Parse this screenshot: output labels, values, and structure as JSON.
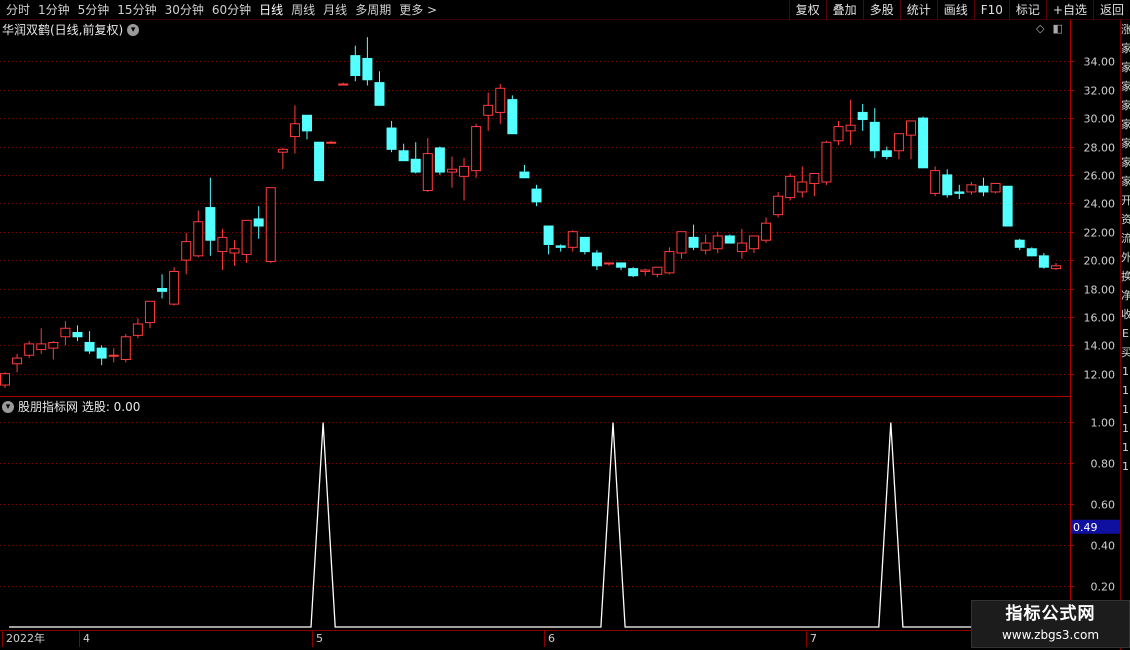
{
  "toolbar": {
    "periods": [
      "分时",
      "1分钟",
      "5分钟",
      "15分钟",
      "30分钟",
      "60分钟",
      "日线",
      "周线",
      "月线",
      "多周期",
      "更多 >"
    ],
    "active_period": "日线",
    "actions": [
      "复权",
      "叠加",
      "多股",
      "统计",
      "画线",
      "F10",
      "标记",
      "+自选",
      "返回"
    ]
  },
  "main_chart": {
    "title": "华润双鹤(日线,前复权)",
    "icons": [
      "◇",
      "◧"
    ],
    "y_ticks": [
      "34.00",
      "32.00",
      "30.00",
      "28.00",
      "26.00",
      "24.00",
      "22.00",
      "20.00",
      "18.00",
      "16.00",
      "14.00",
      "12.00"
    ]
  },
  "sub_chart": {
    "title": "股朋指标网 选股: 0.00",
    "y_ticks": [
      "1.00",
      "0.80",
      "0.60",
      "0.40",
      "0.20"
    ],
    "current_value": "0.49"
  },
  "date_axis": [
    "2022年",
    "4",
    "5",
    "6",
    "7"
  ],
  "right_strip": [
    "涨",
    "家",
    "家",
    "家",
    "家",
    "家",
    "家",
    "家",
    "家",
    "开",
    "资",
    "流",
    "外",
    "换",
    "净",
    "收",
    "E",
    "买",
    "1",
    "1",
    "1",
    "1",
    "1",
    "1"
  ],
  "watermark": {
    "line1": "指标公式网",
    "line2": "www.zbgs3.com"
  },
  "colors": {
    "up": "#ff3c3c",
    "down": "#54ffff",
    "grid": "#7a0000",
    "signal": "#ffffff",
    "value_box": "#1010a0"
  },
  "chart_data": [
    {
      "type": "candlestick",
      "title": "华润双鹤(日线,前复权)",
      "ylim": [
        10.5,
        35.5
      ],
      "ohlc": [
        [
          11.2,
          12.1,
          11.0,
          12.0
        ],
        [
          12.7,
          13.4,
          12.1,
          13.1
        ],
        [
          13.3,
          14.3,
          13.1,
          14.1
        ],
        [
          13.7,
          15.2,
          13.4,
          14.1
        ],
        [
          13.8,
          14.3,
          13.0,
          14.2
        ],
        [
          14.6,
          15.7,
          14.0,
          15.2
        ],
        [
          14.9,
          15.4,
          14.3,
          14.6
        ],
        [
          14.2,
          15.0,
          13.4,
          13.6
        ],
        [
          13.8,
          14.0,
          12.6,
          13.1
        ],
        [
          13.3,
          13.8,
          12.8,
          13.3
        ],
        [
          13.0,
          14.8,
          12.8,
          14.6
        ],
        [
          14.7,
          15.9,
          14.5,
          15.5
        ],
        [
          15.6,
          17.1,
          15.2,
          17.1
        ],
        [
          18.0,
          19.0,
          17.3,
          17.8
        ],
        [
          16.9,
          19.5,
          16.8,
          19.2
        ],
        [
          20.0,
          21.9,
          19.0,
          21.3
        ],
        [
          20.3,
          23.5,
          20.2,
          22.7
        ],
        [
          23.7,
          25.8,
          20.3,
          21.4
        ],
        [
          20.6,
          22.2,
          19.3,
          21.6
        ],
        [
          20.5,
          21.4,
          19.6,
          20.8
        ],
        [
          20.4,
          22.6,
          19.8,
          22.8
        ],
        [
          22.9,
          23.8,
          21.5,
          22.4
        ],
        [
          19.9,
          25.1,
          19.8,
          25.1
        ],
        [
          27.6,
          27.9,
          26.4,
          27.8
        ],
        [
          28.7,
          30.9,
          27.5,
          29.6
        ],
        [
          30.2,
          28.5,
          28.5,
          29.1
        ],
        [
          28.3,
          28.3,
          25.6,
          25.6
        ],
        [
          28.3,
          28.4,
          28.2,
          28.3
        ],
        [
          32.4,
          32.5,
          32.3,
          32.4
        ],
        [
          34.4,
          35.1,
          32.6,
          33.0
        ],
        [
          34.2,
          35.7,
          32.3,
          32.7
        ],
        [
          32.5,
          33.3,
          31.1,
          30.9
        ],
        [
          29.3,
          29.8,
          27.6,
          27.8
        ],
        [
          27.7,
          28.2,
          27.0,
          27.0
        ],
        [
          27.1,
          28.3,
          26.1,
          26.2
        ],
        [
          24.9,
          28.6,
          24.8,
          27.5
        ],
        [
          27.9,
          28.0,
          26.0,
          26.2
        ],
        [
          26.2,
          27.3,
          25.1,
          26.4
        ],
        [
          25.9,
          27.2,
          24.2,
          26.6
        ],
        [
          26.3,
          29.6,
          25.8,
          29.4
        ],
        [
          30.2,
          31.8,
          29.1,
          30.9
        ],
        [
          30.4,
          32.4,
          29.6,
          32.1
        ],
        [
          31.3,
          31.6,
          28.9,
          28.9
        ],
        [
          26.2,
          26.7,
          25.8,
          25.8
        ],
        [
          25.0,
          25.3,
          23.8,
          24.1
        ],
        [
          22.4,
          22.4,
          20.4,
          21.1
        ],
        [
          21.0,
          21.1,
          20.6,
          20.9
        ],
        [
          20.9,
          22.1,
          20.6,
          22.0
        ],
        [
          21.6,
          21.6,
          20.4,
          20.6
        ],
        [
          20.5,
          20.7,
          19.3,
          19.6
        ],
        [
          19.8,
          19.8,
          19.6,
          19.8
        ],
        [
          19.8,
          19.8,
          19.3,
          19.5
        ],
        [
          19.4,
          19.5,
          18.8,
          18.9
        ],
        [
          19.2,
          19.4,
          18.9,
          19.3
        ],
        [
          19.0,
          19.5,
          18.8,
          19.5
        ],
        [
          19.1,
          20.9,
          19.0,
          20.6
        ],
        [
          20.5,
          22.0,
          20.1,
          22.0
        ],
        [
          21.6,
          22.5,
          20.7,
          20.9
        ],
        [
          20.7,
          21.8,
          20.4,
          21.2
        ],
        [
          20.8,
          22.0,
          20.5,
          21.7
        ],
        [
          21.7,
          21.8,
          21.2,
          21.2
        ],
        [
          20.6,
          22.2,
          20.1,
          21.2
        ],
        [
          20.8,
          21.6,
          20.5,
          21.7
        ],
        [
          21.4,
          23.0,
          21.2,
          22.6
        ],
        [
          23.2,
          24.8,
          23.0,
          24.5
        ],
        [
          24.4,
          26.1,
          24.2,
          25.9
        ],
        [
          24.8,
          26.6,
          24.4,
          25.5
        ],
        [
          25.4,
          26.1,
          24.5,
          26.1
        ],
        [
          25.5,
          28.4,
          25.3,
          28.3
        ],
        [
          28.4,
          29.8,
          28.1,
          29.4
        ],
        [
          29.1,
          31.3,
          28.1,
          29.5
        ],
        [
          30.4,
          31.0,
          29.1,
          29.9
        ],
        [
          29.7,
          30.7,
          27.2,
          27.7
        ],
        [
          27.7,
          28.0,
          27.1,
          27.3
        ],
        [
          27.7,
          28.6,
          27.1,
          28.9
        ],
        [
          28.8,
          28.1,
          27.1,
          29.8
        ],
        [
          30.0,
          30.1,
          26.5,
          26.5
        ],
        [
          24.7,
          26.6,
          24.5,
          26.3
        ],
        [
          26.0,
          26.4,
          24.4,
          24.6
        ],
        [
          24.8,
          25.3,
          24.3,
          24.7
        ],
        [
          24.8,
          25.5,
          24.6,
          25.3
        ],
        [
          25.2,
          25.8,
          24.5,
          24.8
        ],
        [
          24.8,
          25.4,
          24.7,
          25.4
        ],
        [
          25.2,
          25.2,
          22.4,
          22.4
        ],
        [
          21.4,
          21.5,
          20.7,
          20.9
        ],
        [
          20.8,
          20.9,
          20.3,
          20.3
        ],
        [
          20.3,
          20.5,
          19.4,
          19.5
        ],
        [
          19.4,
          19.8,
          19.3,
          19.6
        ]
      ]
    },
    {
      "type": "line",
      "title": "股朋指标网 选股",
      "ylim": [
        0,
        1.1
      ],
      "series": [
        {
          "values": [
            0,
            0,
            0,
            0,
            0,
            0,
            0,
            0,
            0,
            0,
            0,
            0,
            0,
            0,
            0,
            0,
            0,
            0,
            0,
            0,
            0,
            0,
            0,
            0,
            0,
            0,
            1,
            0,
            0,
            0,
            0,
            0,
            0,
            0,
            0,
            0,
            0,
            0,
            0,
            0,
            0,
            0,
            0,
            0,
            0,
            0,
            0,
            0,
            0,
            0,
            1,
            0,
            0,
            0,
            0,
            0,
            0,
            0,
            0,
            0,
            0,
            0,
            0,
            0,
            0,
            0,
            0,
            0,
            0,
            0,
            0,
            0,
            0,
            1,
            0,
            0,
            0,
            0,
            0,
            0,
            0,
            0,
            0,
            0,
            0,
            0,
            0,
            0,
            0
          ]
        }
      ]
    }
  ]
}
